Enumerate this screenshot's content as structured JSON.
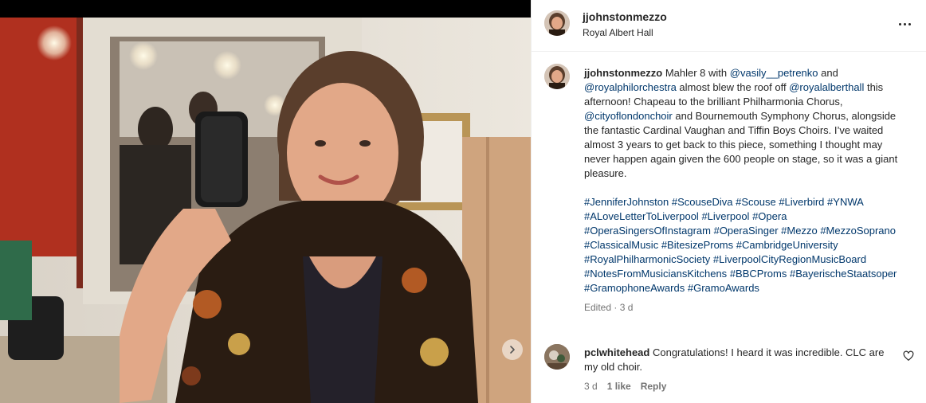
{
  "post": {
    "username": "jjohnstonmezzo",
    "location": "Royal Albert Hall",
    "more_icon": "more-horizontal-icon"
  },
  "caption": {
    "username": "jjohnstonmezzo",
    "segments": [
      {
        "type": "text",
        "value": " Mahler 8 with "
      },
      {
        "type": "mention",
        "value": "@vasily__petrenko"
      },
      {
        "type": "text",
        "value": " and "
      },
      {
        "type": "mention",
        "value": "@royalphilorchestra"
      },
      {
        "type": "text",
        "value": " almost blew the roof off "
      },
      {
        "type": "mention",
        "value": "@royalalberthall"
      },
      {
        "type": "text",
        "value": " this afternoon! Chapeau to the brilliant Philharmonia Chorus, "
      },
      {
        "type": "mention",
        "value": "@cityoflondonchoir"
      },
      {
        "type": "text",
        "value": " and Bournemouth Symphony Chorus, alongside the fantastic Cardinal Vaughan and Tiffin Boys Choirs. I’ve waited almost 3 years to get back to this piece, something I thought may never happen again given the 600 people on stage, so it was a giant pleasure."
      }
    ],
    "hashtags": [
      "#JenniferJohnston",
      "#ScouseDiva",
      "#Scouse",
      "#Liverbird",
      "#YNWA",
      "#ALoveLetterToLiverpool",
      "#Liverpool",
      "#Opera",
      "#OperaSingersOfInstagram",
      "#OperaSinger",
      "#Mezzo",
      "#MezzoSoprano",
      "#ClassicalMusic",
      "#BitesizeProms",
      "#CambridgeUniversity",
      "#RoyalPhilharmonicSociety",
      "#LiverpoolCityRegionMusicBoard",
      "#NotesFromMusiciansKitchens",
      "#BBCProms",
      "#BayerischeStaatsoper",
      "#GramophoneAwards",
      "#GramoAwards"
    ],
    "meta": "Edited · 3 d"
  },
  "comment": {
    "username": "pclwhitehead",
    "text": " Congratulations! I heard it was incredible. CLC are my old choir.",
    "age": "3 d",
    "likes": "1 like",
    "reply": "Reply"
  },
  "colors": {
    "link": "#00376b",
    "text": "#262626",
    "muted": "#737373",
    "border": "#efefef"
  }
}
